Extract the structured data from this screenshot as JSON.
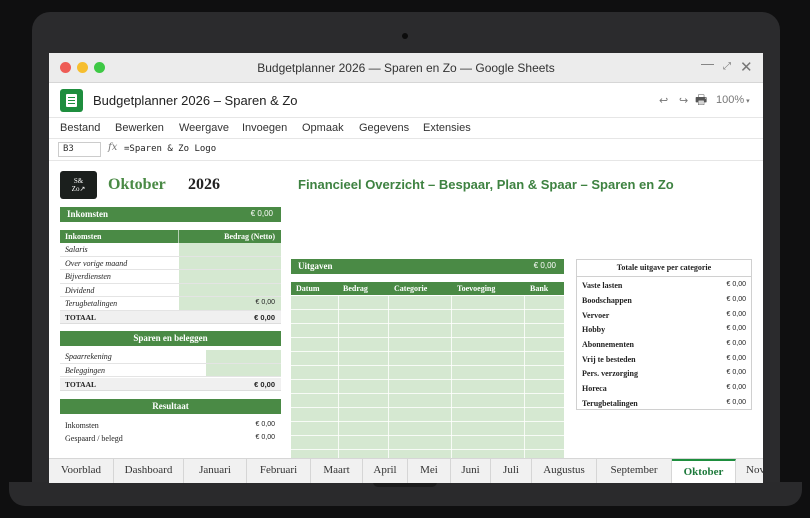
{
  "window": {
    "title": "Budgetplanner 2026 — Sparen en Zo — Google Sheets"
  },
  "doc": {
    "title": "Budgetplanner 2026 – Sparen & Zo",
    "zoom": "100%"
  },
  "menu": [
    "Bestand",
    "Bewerken",
    "Weergave",
    "Invoegen",
    "Opmaak",
    "Gegevens",
    "Extensies"
  ],
  "formula": {
    "cell": "B3",
    "fx": "fx",
    "value": "=Sparen & Zo Logo"
  },
  "sheet": {
    "logo_text": "S&\nZo↗",
    "month": "Oktober",
    "year": "2026",
    "headline": "Financieel Overzicht – Bespaar, Plan & Spaar – Sparen en Zo",
    "inkomsten": {
      "title": "Inkomsten",
      "total": "€ 0,00",
      "col1": "Inkomsten",
      "col2": "Bedrag (Netto)",
      "rows": [
        "Salaris",
        "Over vorige maand",
        "Bijverdiensten",
        "Dividend",
        "Terugbetalingen"
      ],
      "terug_value": "€ 0,00",
      "totaal_label": "TOTAAL",
      "totaal_value": "€ 0,00"
    },
    "sparen": {
      "title": "Sparen en beleggen",
      "rows": [
        "Spaarrekening",
        "Beleggingen"
      ],
      "totaal_label": "TOTAAL",
      "totaal_value": "€ 0,00"
    },
    "resultaat": {
      "title": "Resultaat",
      "rows": [
        {
          "label": "Inkomsten",
          "value": "€ 0,00"
        },
        {
          "label": "Gespaard / belegd",
          "value": "€ 0,00"
        }
      ]
    },
    "uitgaven": {
      "title": "Uitgaven",
      "total": "€ 0,00",
      "columns": [
        "Datum",
        "Bedrag",
        "Categorie",
        "Toevoeging",
        "Bank"
      ]
    },
    "categories": {
      "title": "Totale uitgave per categorie",
      "rows": [
        {
          "label": "Vaste lasten",
          "value": "€ 0,00"
        },
        {
          "label": "Boodschappen",
          "value": "€ 0,00"
        },
        {
          "label": "Vervoer",
          "value": "€ 0,00"
        },
        {
          "label": "Hobby",
          "value": "€ 0,00"
        },
        {
          "label": "Abonnementen",
          "value": "€ 0,00"
        },
        {
          "label": "Vrij te besteden",
          "value": "€ 0,00"
        },
        {
          "label": "Pers. verzorging",
          "value": "€ 0,00"
        },
        {
          "label": "Horeca",
          "value": "€ 0,00"
        },
        {
          "label": "Terugbetalingen",
          "value": "€ 0,00"
        }
      ]
    }
  },
  "tabs": [
    "Voorblad",
    "Dashboard",
    "Januari",
    "Februari",
    "Maart",
    "April",
    "Mei",
    "Juni",
    "Juli",
    "Augustus",
    "September",
    "Oktober",
    "Nov"
  ],
  "active_tab": "Oktober",
  "colors": {
    "accent": "#4a8a45",
    "cell_fill": "#d5e8d1",
    "brand": "#1e8e3e"
  }
}
